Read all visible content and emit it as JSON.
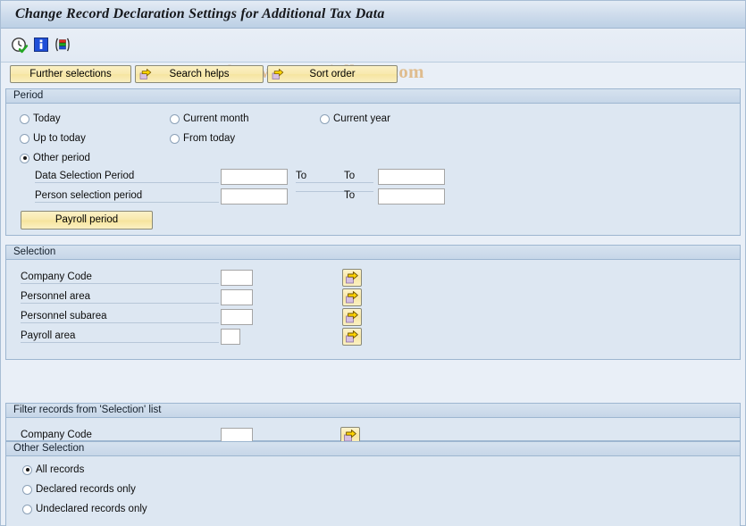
{
  "window": {
    "title": "Change Record Declaration Settings for Additional Tax Data",
    "watermark": "© www.tutorialkart.com"
  },
  "toolbar": {
    "icons": [
      {
        "name": "execute-clock-icon",
        "title": "Execute"
      },
      {
        "name": "info-icon",
        "title": "Information"
      },
      {
        "name": "layout-variant-icon",
        "title": "Get Variant"
      }
    ]
  },
  "button_row": [
    {
      "label": "Further selections",
      "has_arrow": false
    },
    {
      "label": "Search helps",
      "has_arrow": true
    },
    {
      "label": "Sort order",
      "has_arrow": true
    }
  ],
  "period": {
    "title": "Period",
    "radios": [
      {
        "label": "Today",
        "checked": false
      },
      {
        "label": "Current month",
        "checked": false
      },
      {
        "label": "Current year",
        "checked": false
      },
      {
        "label": "Up to today",
        "checked": false
      },
      {
        "label": "From today",
        "checked": false
      },
      {
        "label": "Other period",
        "checked": true
      }
    ],
    "rows": [
      {
        "label": "Data Selection Period",
        "value": "",
        "to_label": "To",
        "to_value": ""
      },
      {
        "label": "Person selection period",
        "value": "",
        "to_label": "To",
        "to_value": ""
      }
    ],
    "payroll_button": "Payroll period"
  },
  "selection": {
    "title": "Selection",
    "rows": [
      {
        "label": "Company Code",
        "value": ""
      },
      {
        "label": "Personnel area",
        "value": ""
      },
      {
        "label": "Personnel subarea",
        "value": ""
      },
      {
        "label": "Payroll area",
        "value": ""
      }
    ]
  },
  "filter": {
    "title": "Filter records from 'Selection' list",
    "rows": [
      {
        "label": "Company Code",
        "value": ""
      }
    ]
  },
  "other_selection": {
    "title": "Other Selection",
    "radios": [
      {
        "label": "All records",
        "checked": true
      },
      {
        "label": "Declared records only",
        "checked": false
      },
      {
        "label": "Undeclared records only",
        "checked": false
      }
    ]
  },
  "colors": {
    "window_bg": "#e9eff7",
    "group_bg": "#dde7f2",
    "group_border": "#9db6d0",
    "button_yellow": "#f8e8ab",
    "watermark": "#dfbc8e",
    "title_text": "#16181c"
  }
}
